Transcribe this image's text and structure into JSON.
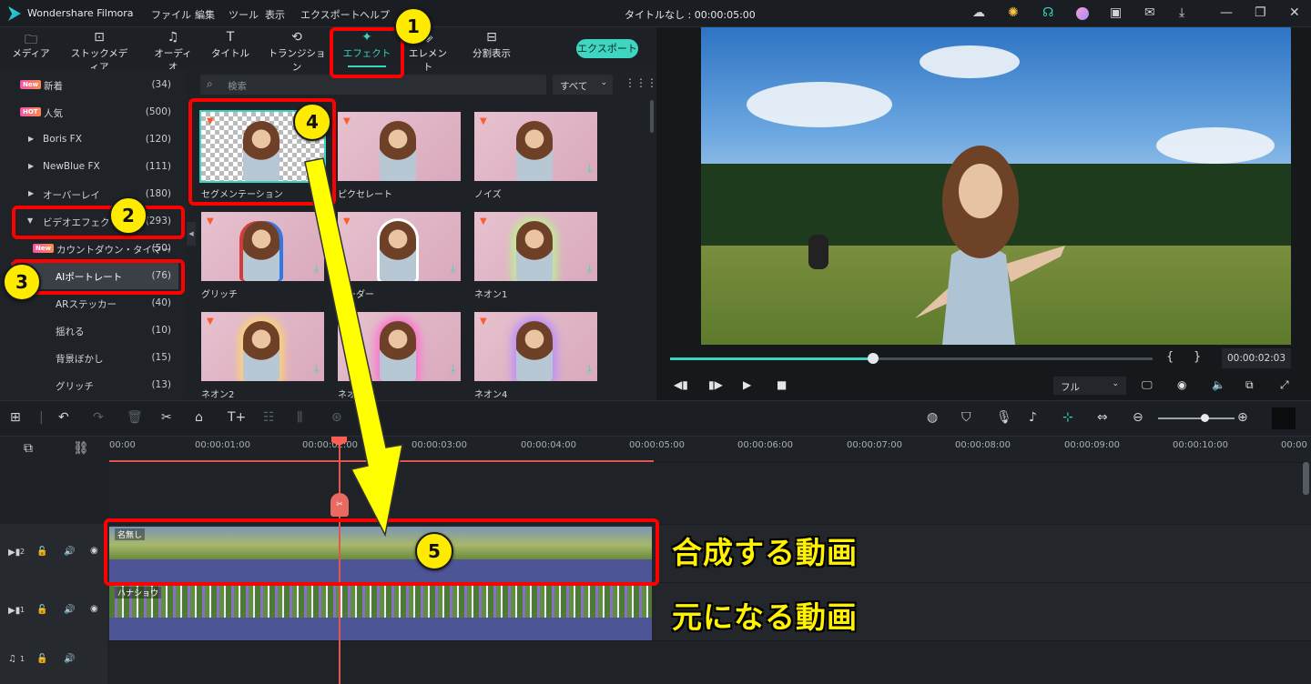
{
  "titlebar": {
    "app_name": "Wondershare Filmora",
    "menus": [
      "ファイル",
      "編集",
      "ツール",
      "表示",
      "エクスポート",
      "ヘルプ"
    ],
    "project_title": "タイトルなし : 00:00:05:00"
  },
  "nav": {
    "items": [
      "メディア",
      "ストックメディア",
      "オーディオ",
      "タイトル",
      "トランジション",
      "エフェクト",
      "エレメント",
      "分割表示"
    ],
    "active": "エフェクト",
    "export_label": "エクスポート"
  },
  "sidebar": {
    "items": [
      {
        "badge": "New",
        "label": "新着",
        "count": "(34)"
      },
      {
        "badge": "HOT",
        "label": "人気",
        "count": "(500)"
      },
      {
        "label": "Boris FX",
        "count": "(120)"
      },
      {
        "label": "NewBlue FX",
        "count": "(111)"
      },
      {
        "label": "オーバーレイ",
        "count": "(180)"
      },
      {
        "label": "ビデオエフェクト",
        "count": "(293)"
      },
      {
        "badge": "New",
        "label": "カウントダウン・タイマー",
        "count": "(50)"
      },
      {
        "label": "AIポートレート",
        "count": "(76)"
      },
      {
        "label": "ARステッカー",
        "count": "(40)"
      },
      {
        "label": "揺れる",
        "count": "(10)"
      },
      {
        "label": "背景ぼかし",
        "count": "(15)"
      },
      {
        "label": "グリッチ",
        "count": "(13)"
      }
    ],
    "selected": "AIポートレート"
  },
  "search": {
    "placeholder": "検索",
    "filter": "すべて"
  },
  "effects": [
    {
      "label": "セグメンテーション"
    },
    {
      "label": "ピクセレート"
    },
    {
      "label": "ノイズ"
    },
    {
      "label": "グリッチ"
    },
    {
      "label": "ボーダー"
    },
    {
      "label": "ネオン1"
    },
    {
      "label": "ネオン2"
    },
    {
      "label": "ネオン3"
    },
    {
      "label": "ネオン4"
    }
  ],
  "preview": {
    "progress": 0.42,
    "timecode": "00:00:02:03",
    "quality": "フル",
    "brace_open": "{",
    "brace_close": "}"
  },
  "timeline": {
    "ruler_labels": [
      "00:00",
      "00:00:01:00",
      "00:00:02:00",
      "00:00:03:00",
      "00:00:04:00",
      "00:00:05:00",
      "00:00:06:00",
      "00:00:07:00",
      "00:00:08:00",
      "00:00:09:00",
      "00:00:10:00",
      "00:00"
    ],
    "tracks": [
      {
        "icon": "video-track-icon",
        "num": "2",
        "clip": "名無し"
      },
      {
        "icon": "video-track-icon",
        "num": "1",
        "clip": "ハナショウ"
      },
      {
        "icon": "music-track-icon",
        "num": "1"
      }
    ]
  },
  "annotations": {
    "callouts": [
      "1",
      "2",
      "3",
      "4",
      "5"
    ],
    "label_top": "合成する動画",
    "label_bottom": "元になる動画",
    "color": "#ff0000",
    "arrow_color": "#ffff00"
  }
}
